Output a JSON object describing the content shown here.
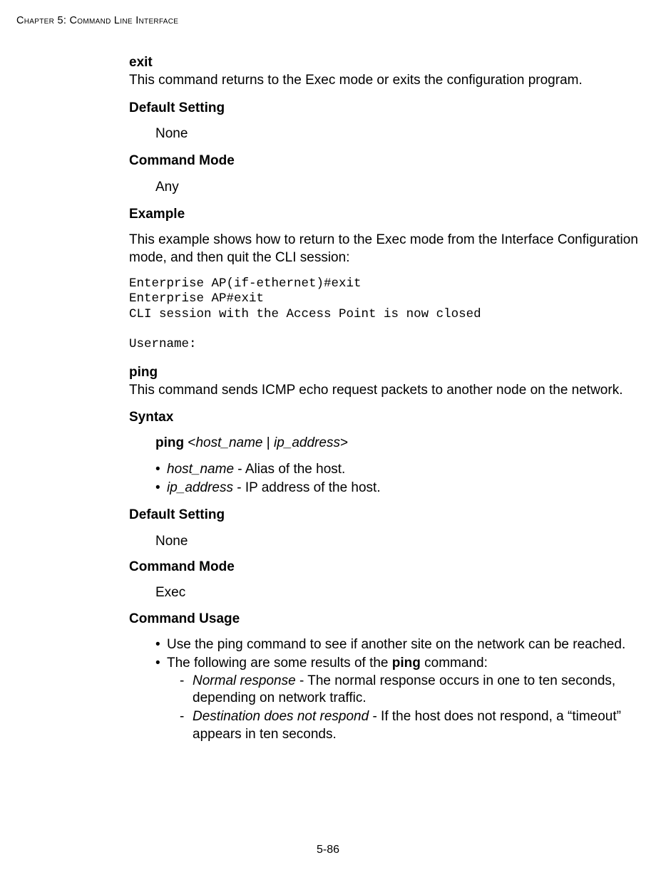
{
  "header": {
    "running": "Chapter 5: Command Line Interface"
  },
  "exit": {
    "name": "exit",
    "desc": "This command returns to the Exec mode or exits the configuration program.",
    "default_label": "Default Setting",
    "default_value": "None",
    "mode_label": "Command Mode",
    "mode_value": "Any",
    "example_label": "Example",
    "example_desc": "This example shows how to return to the Exec mode from the Interface Configuration mode, and then quit the CLI session:",
    "code": "Enterprise AP(if-ethernet)#exit\nEnterprise AP#exit\nCLI session with the Access Point is now closed\n\nUsername:"
  },
  "ping": {
    "name": "ping",
    "desc": "This command sends ICMP echo request packets to another node on the network.",
    "syntax_label": "Syntax",
    "syntax_cmd": "ping",
    "syntax_args_open": " <",
    "syntax_args_mid": " | ",
    "syntax_args_close": ">",
    "arg1_name": "host_name",
    "arg1_desc": " - Alias of the host.",
    "arg2_name": "ip_address",
    "arg2_desc": " - IP address of the host.",
    "default_label": "Default Setting",
    "default_value": "None",
    "mode_label": "Command Mode",
    "mode_value": "Exec",
    "usage_label": "Command Usage",
    "usage1": "Use the ping command to see if another site on the network can be reached.",
    "usage2_prefix": "The following are some results of the ",
    "usage2_bold": "ping",
    "usage2_suffix": " command:",
    "res1_name": "Normal response",
    "res1_desc": " - The normal response occurs in one to ten seconds, depending on network traffic.",
    "res2_name": "Destination does not respond",
    "res2_desc": " - If the host does not respond, a “timeout” appears in ten seconds."
  },
  "footer": {
    "page": "5-86"
  }
}
